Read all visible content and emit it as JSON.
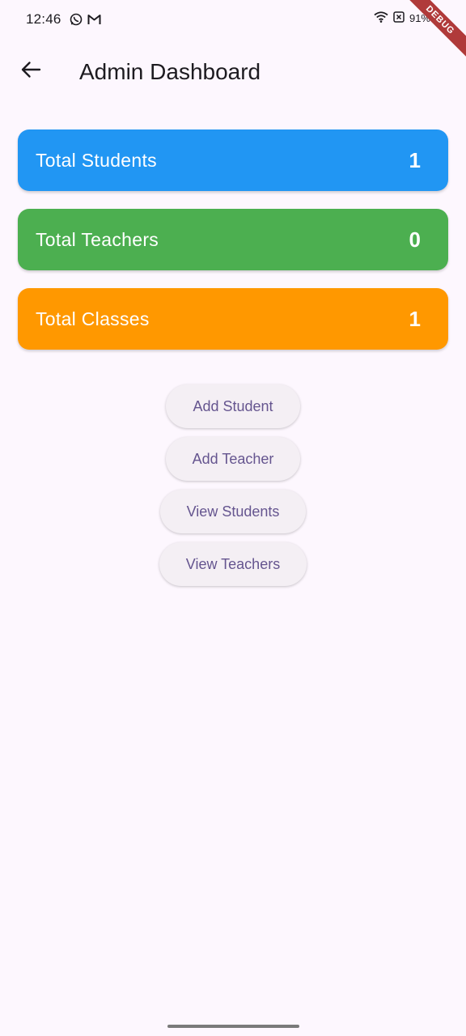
{
  "status_bar": {
    "time": "12:46",
    "battery": "91%",
    "icons": [
      "whatsapp-icon",
      "gmail-icon",
      "wifi-icon",
      "no-sim-icon",
      "battery-icon"
    ]
  },
  "debug_banner": {
    "label": "DEBUG",
    "color": "#b03a3a"
  },
  "app_bar": {
    "title": "Admin Dashboard",
    "back_icon": "arrow-back-icon"
  },
  "stats": [
    {
      "label": "Total Students",
      "value": "1",
      "color": "#2196f3"
    },
    {
      "label": "Total Teachers",
      "value": "0",
      "color": "#4caf50"
    },
    {
      "label": "Total Classes",
      "value": "1",
      "color": "#ff9800"
    }
  ],
  "actions": {
    "add_student": "Add Student",
    "add_teacher": "Add Teacher",
    "view_students": "View Students",
    "view_teachers": "View Teachers"
  },
  "theme": {
    "background": "#fdf7fe",
    "button_bg": "#f4eff4",
    "button_text": "#65558f"
  }
}
